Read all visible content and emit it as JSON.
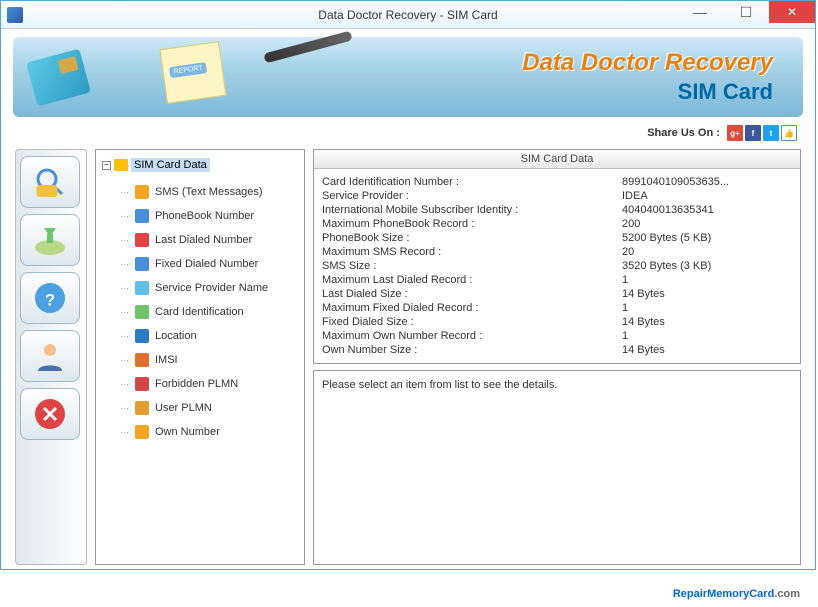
{
  "window": {
    "title": "Data Doctor Recovery - SIM Card"
  },
  "banner": {
    "brand_main": "Data Doctor Recovery",
    "brand_sub": "SIM Card"
  },
  "share": {
    "label": "Share Us On :"
  },
  "tree": {
    "root": "SIM Card Data",
    "items": [
      {
        "label": "SMS (Text Messages)",
        "color": "#f5a623"
      },
      {
        "label": "PhoneBook Number",
        "color": "#4a90d9"
      },
      {
        "label": "Last Dialed Number",
        "color": "#e04343"
      },
      {
        "label": "Fixed Dialed Number",
        "color": "#4a90d9"
      },
      {
        "label": "Service Provider Name",
        "color": "#60c0e8"
      },
      {
        "label": "Card Identification",
        "color": "#6fc36f"
      },
      {
        "label": "Location",
        "color": "#2d7cc0"
      },
      {
        "label": "IMSI",
        "color": "#e07030"
      },
      {
        "label": "Forbidden PLMN",
        "color": "#d04848"
      },
      {
        "label": "User PLMN",
        "color": "#e0a030"
      },
      {
        "label": "Own Number",
        "color": "#f5a623"
      }
    ]
  },
  "table": {
    "header": "SIM Card Data",
    "rows": [
      {
        "label": "Card Identification Number :",
        "value": "8991040109053635..."
      },
      {
        "label": "Service Provider :",
        "value": "IDEA"
      },
      {
        "label": "International Mobile Subscriber Identity :",
        "value": "404040013635341"
      },
      {
        "label": "Maximum PhoneBook Record :",
        "value": "200"
      },
      {
        "label": "PhoneBook Size :",
        "value": "5200 Bytes (5 KB)"
      },
      {
        "label": "Maximum SMS Record :",
        "value": "20"
      },
      {
        "label": "SMS Size :",
        "value": "3520 Bytes (3 KB)"
      },
      {
        "label": "Maximum Last Dialed Record :",
        "value": "1"
      },
      {
        "label": "Last Dialed Size :",
        "value": "14 Bytes"
      },
      {
        "label": "Maximum Fixed Dialed Record :",
        "value": "1"
      },
      {
        "label": "Fixed Dialed Size :",
        "value": "14 Bytes"
      },
      {
        "label": "Maximum Own Number Record :",
        "value": "1"
      },
      {
        "label": "Own Number Size :",
        "value": "14 Bytes"
      }
    ]
  },
  "details": {
    "placeholder": "Please select an item from list to see the details."
  },
  "footer": {
    "link_main": "RepairMemoryCard",
    "link_ext": ".com"
  }
}
